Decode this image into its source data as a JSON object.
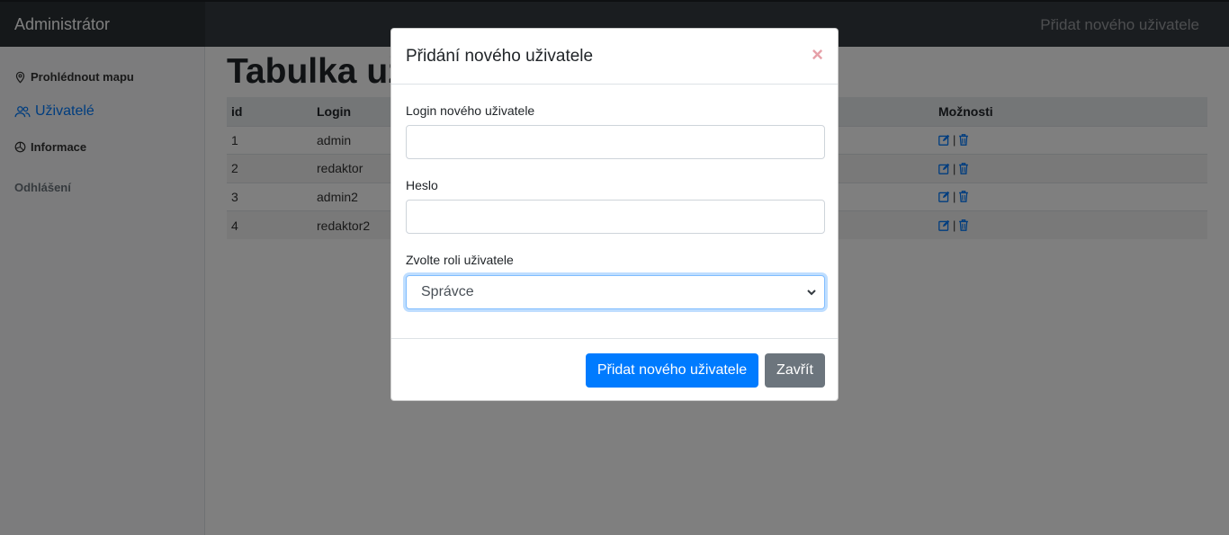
{
  "navbar": {
    "brand": "Administrátor",
    "add_user_link": "Přidat nového uživatele"
  },
  "sidebar": {
    "items": [
      {
        "label": "Prohlédnout mapu",
        "icon": "map-pin-icon"
      },
      {
        "label": "Uživatelé",
        "icon": "users-icon",
        "active": true
      },
      {
        "label": "Informace",
        "icon": "pie-chart-icon"
      },
      {
        "label": "Odhlášení"
      }
    ]
  },
  "main": {
    "title": "Tabulka uživatelů",
    "table": {
      "headers": [
        "id",
        "Login",
        "Možnosti"
      ],
      "rows": [
        {
          "id": "1",
          "login": "admin"
        },
        {
          "id": "2",
          "login": "redaktor"
        },
        {
          "id": "3",
          "login": "admin2"
        },
        {
          "id": "4",
          "login": "redaktor2"
        }
      ]
    }
  },
  "modal": {
    "title": "Přidání nového uživatele",
    "close_symbol": "×",
    "login_label": "Login nového uživatele",
    "login_value": "",
    "password_label": "Heslo",
    "password_value": "",
    "role_label": "Zvolte roli uživatele",
    "role_selected": "Správce",
    "submit_label": "Přidat nového uživatele",
    "close_label": "Zavřít"
  },
  "colors": {
    "primary": "#007bff",
    "secondary": "#6c757d",
    "navbar": "#343a40"
  }
}
